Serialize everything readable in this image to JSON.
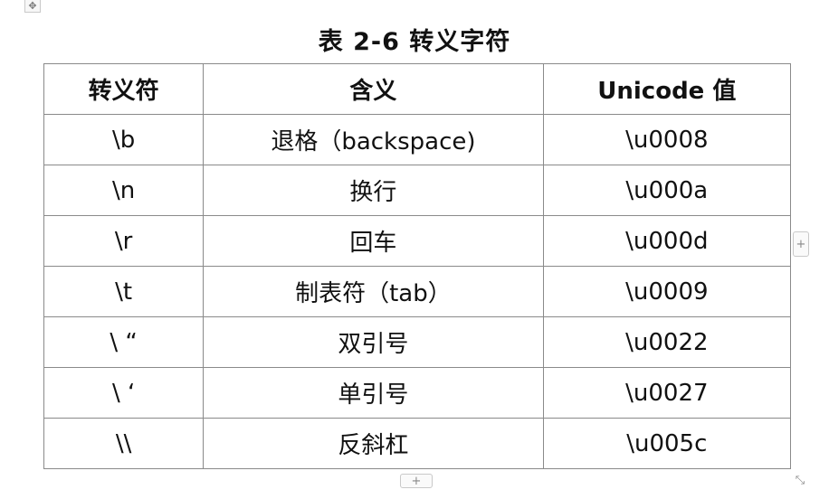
{
  "title": "表 2-6  转义字符",
  "table": {
    "headers": [
      "转义符",
      "含义",
      "Unicode 值"
    ],
    "rows": [
      [
        "\\b",
        "退格（backspace)",
        "\\u0008"
      ],
      [
        "\\n",
        "换行",
        "\\u000a"
      ],
      [
        "\\r",
        "回车",
        "\\u000d"
      ],
      [
        "\\t",
        "制表符（tab）",
        "\\u0009"
      ],
      [
        "\\ “",
        "双引号",
        "\\u0022"
      ],
      [
        "\\ ‘",
        "单引号",
        "\\u0027"
      ],
      [
        "\\\\",
        "反斜杠",
        "\\u005c"
      ]
    ]
  },
  "controls": {
    "move_glyph": "✥",
    "add_glyph": "+",
    "resize_glyph": "⤡"
  },
  "icons": [
    "move-icon",
    "add-column-icon",
    "add-row-icon",
    "resize-icon"
  ]
}
